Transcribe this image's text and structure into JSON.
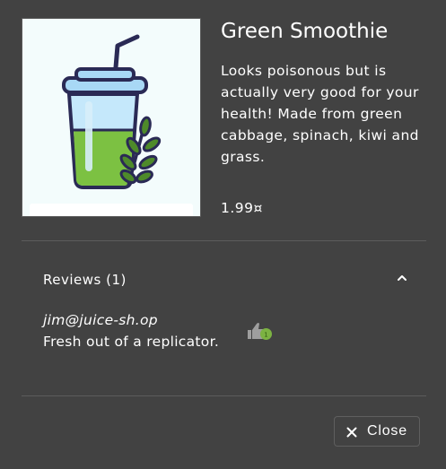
{
  "product": {
    "name": "Green Smoothie",
    "description": "Looks poisonous but is actually very good for your health! Made from green cabbage, spinach, kiwi and grass.",
    "price": "1.99¤",
    "image_icon": "smoothie-cup-illustration"
  },
  "reviews": {
    "header_label": "Reviews (1)",
    "expanded": true,
    "items": [
      {
        "author": "jim@juice-sh.op",
        "text": "Fresh out of a replicator.",
        "like_icon": "thumbs-up-icon",
        "like_badge_color": "#7cb342"
      }
    ]
  },
  "actions": {
    "close_label": "Close",
    "close_icon": "close-icon"
  },
  "colors": {
    "background": "#424242",
    "image_background": "#f3fcfc",
    "accent_green": "#7cb342"
  }
}
